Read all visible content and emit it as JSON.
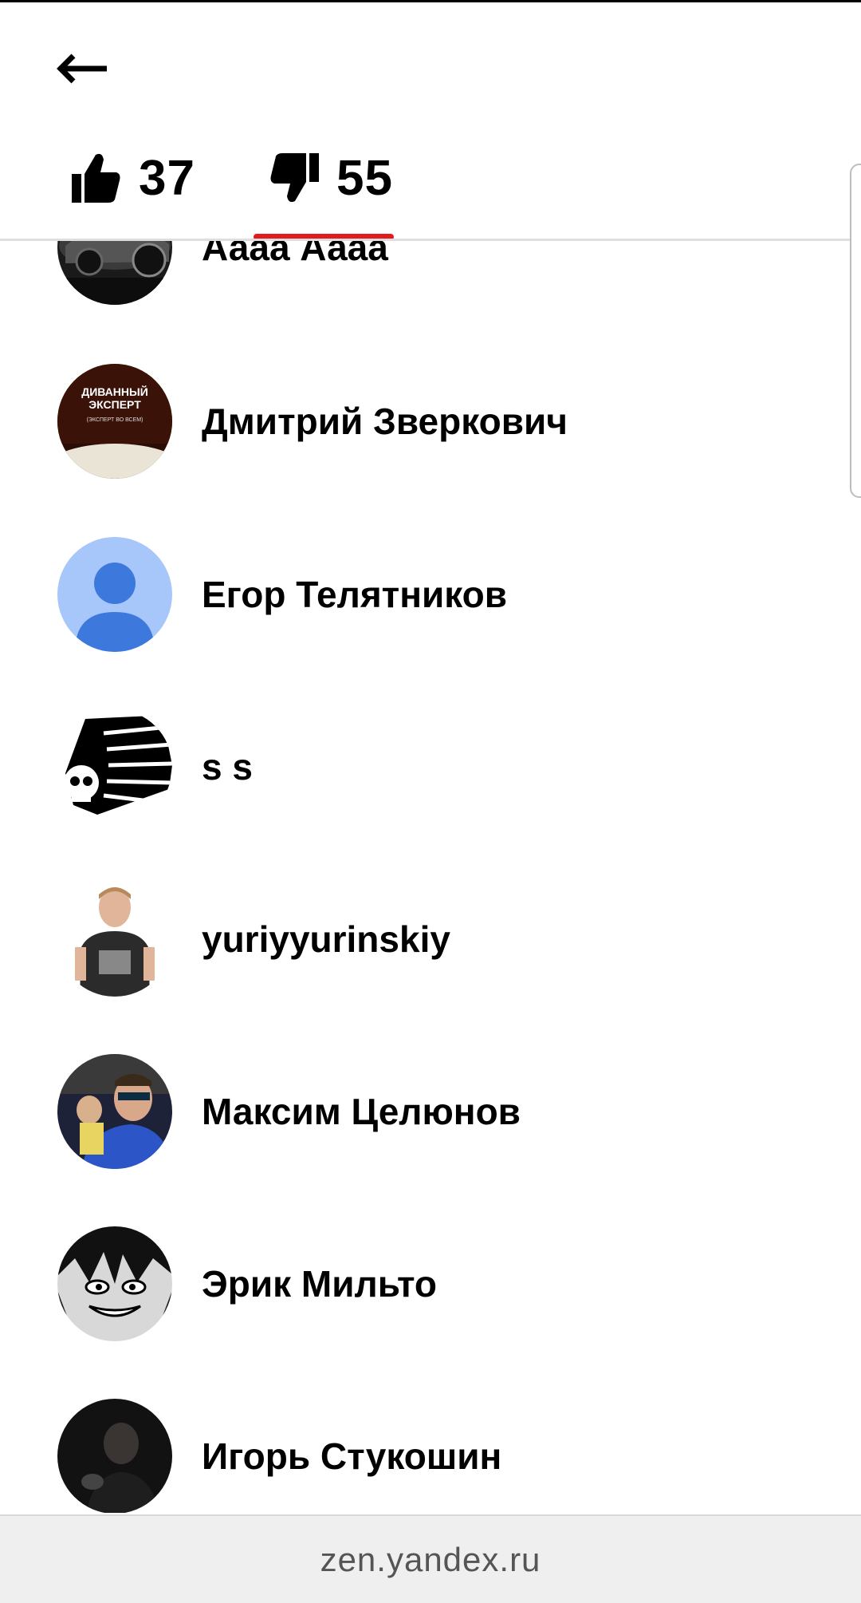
{
  "header": {
    "back_icon": "arrow-left-icon",
    "tabs": [
      {
        "icon": "thumbs-up-icon",
        "count": "37",
        "active": false
      },
      {
        "icon": "thumbs-down-icon",
        "count": "55",
        "active": true
      }
    ],
    "accent_color": "#e01c1c"
  },
  "users": [
    {
      "name": "Аааа Аааа",
      "avatar": "car-photo-avatar"
    },
    {
      "name": "Дмитрий Зверкович",
      "avatar": "divan-expert-avatar",
      "avatar_text": [
        "ДИВАННЫЙ",
        "ЭКСПЕРТ",
        "(ЭКСПЕРТ ВО ВСЕМ)"
      ]
    },
    {
      "name": "Егор Телятников",
      "avatar": "default-person-avatar"
    },
    {
      "name": "s s",
      "avatar": "skull-logo-avatar"
    },
    {
      "name": "yuriyyurinskiy",
      "avatar": "person-photo-avatar"
    },
    {
      "name": "Максим Целюнов",
      "avatar": "person-photo-avatar"
    },
    {
      "name": "Эрик Мильто",
      "avatar": "anime-avatar"
    },
    {
      "name": "Игорь Стукошин",
      "avatar": "dark-photo-avatar"
    }
  ],
  "footer": {
    "url": "zen.yandex.ru"
  }
}
